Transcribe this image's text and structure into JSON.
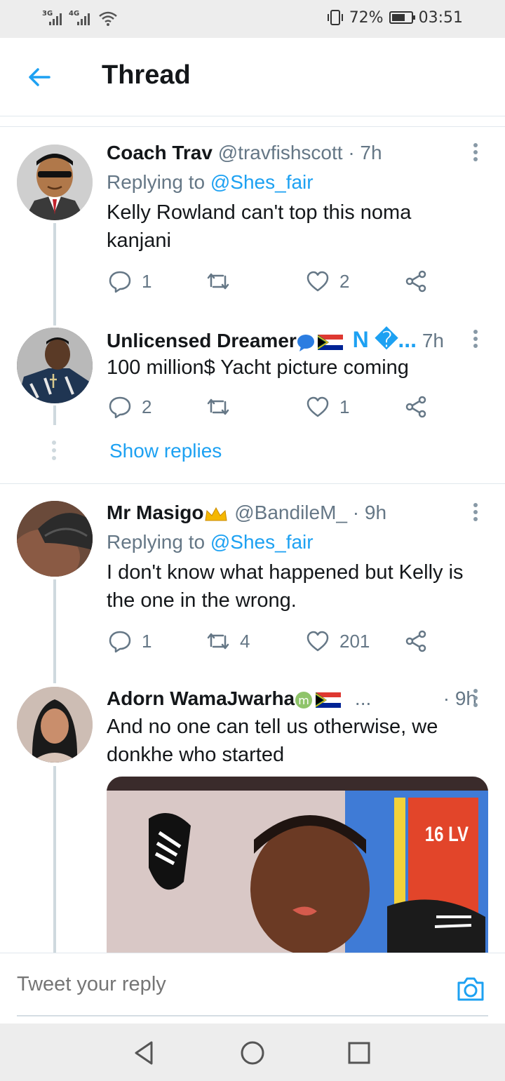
{
  "status_bar": {
    "signal1": "3G",
    "signal2": "4G",
    "battery": "72%",
    "battery_level": 0.72,
    "time": "03:51"
  },
  "header": {
    "title": "Thread"
  },
  "tweets": [
    {
      "name": "Coach Trav",
      "handle": "@travfishscott",
      "time": "· 7h",
      "replying_prefix": "Replying to",
      "replying_to": "@Shes_fair",
      "text": "Kelly Rowland can't top this noma kanjani",
      "replies": "1",
      "retweets": "",
      "likes": "2"
    },
    {
      "name": "Unlicensed Dreamer",
      "name_suffix": "N �...",
      "handle": "",
      "time": "7h",
      "text": "100 million$ Yacht picture coming",
      "replies": "2",
      "retweets": "",
      "likes": "1",
      "show_replies": "Show replies"
    },
    {
      "name": "Mr Masigo",
      "handle": "@BandileM_",
      "time": "· 9h",
      "replying_prefix": "Replying to",
      "replying_to": "@Shes_fair",
      "text": "I don't know what happened but Kelly is the one in the wrong.",
      "replies": "1",
      "retweets": "4",
      "likes": "201"
    },
    {
      "name": "Adorn WamaJwarha",
      "name_suffix": "...",
      "handle": "",
      "time": "· 9h",
      "text": "And no one can tell us otherwise, we donkhe who started",
      "media_label": "16 LV"
    }
  ],
  "composer": {
    "placeholder": "Tweet your reply"
  },
  "colors": {
    "accent": "#1da1f2",
    "muted": "#657786",
    "text": "#14171a"
  }
}
